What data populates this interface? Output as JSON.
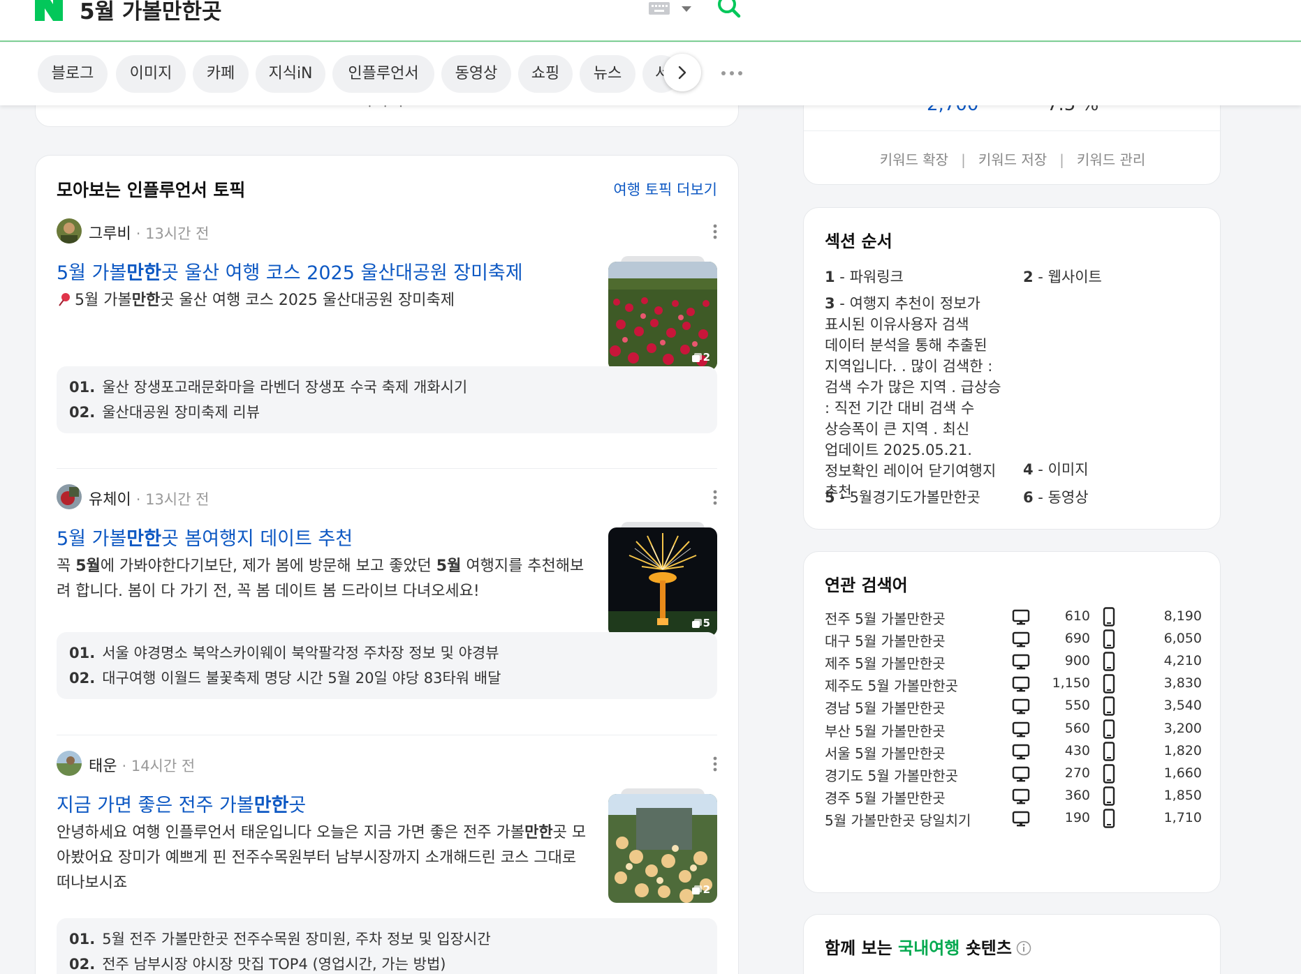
{
  "header": {
    "query": "5월 가볼만한곳",
    "brand_color": "#03c75a",
    "icons": [
      "naver-logo-icon",
      "keyboard-icon",
      "chevron-down-icon",
      "search-icon"
    ]
  },
  "tabs": [
    {
      "label": "블로그"
    },
    {
      "label": "이미지"
    },
    {
      "label": "카페"
    },
    {
      "label": "지식iN"
    },
    {
      "label": "인플루언서"
    },
    {
      "label": "동영상"
    },
    {
      "label": "쇼핑"
    },
    {
      "label": "뉴스"
    },
    {
      "label": "서"
    }
  ],
  "influencer": {
    "title": "모아보는 인플루언서 토픽",
    "more_link": "여행 토픽 더보기",
    "link_color": "#0d58c3",
    "posts": [
      {
        "author": "그루비",
        "time": "· 13시간 전",
        "title_pre": "5월 가볼",
        "title_bold": "만한",
        "title_post": "곳 울산 여행 코스 2025 울산대공원 장미축제",
        "desc_pre": "5월 가볼",
        "desc_bold": "만한",
        "desc_post": "곳 울산 여행 코스 2025 울산대공원 장미축제",
        "image_count": "2",
        "subs": [
          {
            "num": "01.",
            "text": "울산 장생포고래문화마을 라벤더 장생포 수국 축제 개화시기"
          },
          {
            "num": "02.",
            "text": "울산대공원 장미축제 리뷰"
          }
        ]
      },
      {
        "author": "유체이",
        "time": "· 13시간 전",
        "title_pre": "5월 가볼",
        "title_bold": "만한",
        "title_post": "곳 봄여행지 데이트 추천",
        "desc_a": "꼭 ",
        "desc_b": "5월",
        "desc_c": "에 가봐야한다기보단, 제가 봄에 방문해 보고 좋았던 ",
        "desc_d": "5월",
        "desc_e": " 여행지를 추천해보려 합니다. 봄이 다 가기 전, 꼭 봄 데이트 봄 드라이브 다녀오세요!",
        "image_count": "5",
        "subs": [
          {
            "num": "01.",
            "text": "서울 야경명소 북악스카이웨이 북악팔각정 주차장 정보 및 야경뷰"
          },
          {
            "num": "02.",
            "text": "대구여행 이월드 불꽃축제 명당 시간 5월 20일 야당 83타워 배달"
          }
        ]
      },
      {
        "author": "태운",
        "time": "· 14시간 전",
        "title_pre": "지금 가면 좋은 전주 가볼",
        "title_bold": "만한",
        "title_post": "곳",
        "desc_a": "안녕하세요 여행 인플루언서 태운입니다 오늘은 지금 가면 좋은 전주 가볼",
        "desc_b": "만한",
        "desc_c": "곳 모아봤어요 장미가 예쁘게 핀 전주수목원부터 남부시장까지 소개해드린 코스 그대로 떠나보시죠",
        "image_count": "2",
        "subs": [
          {
            "num": "01.",
            "text": "5월 전주 가볼만한곳 전주수목원 장미원, 주차 정보 및 입장시간"
          },
          {
            "num": "02.",
            "text": "전주 남부시장 야시장 맛집 TOP4 (영업시간, 가는 방법)"
          }
        ]
      }
    ]
  },
  "keyword": {
    "value_left": "2,700",
    "value_right": "7.5 %",
    "actions": [
      "키워드 확장",
      "키워드 저장",
      "키워드 관리"
    ],
    "separator": "|"
  },
  "section_order": {
    "title": "섹션 순서",
    "items": [
      {
        "num": "1",
        "label": "파워링크"
      },
      {
        "num": "2",
        "label": "웹사이트"
      },
      {
        "num": "3",
        "label": "여행지 추천이 정보가 표시된 이유사용자 검색 데이터 분석을 통해 추출된 지역입니다. . 많이 검색한 : 검색 수가 많은 지역 . 급상승 : 직전 기간 대비 검색 수 상승폭이 큰 지역 . 최신 업데이트 2025.05.21.정보확인 레이어 닫기여행지 추천"
      },
      {
        "num": "4",
        "label": "이미지"
      },
      {
        "num": "5",
        "label": "5월경기도가볼만한곳"
      },
      {
        "num": "6",
        "label": "동영상"
      }
    ],
    "dash": " - "
  },
  "related": {
    "title": "연관 검색어",
    "rows": [
      {
        "keyword": "전주 5월 가볼만한곳",
        "pc": "610",
        "mobile": "8,190"
      },
      {
        "keyword": "대구 5월 가볼만한곳",
        "pc": "690",
        "mobile": "6,050"
      },
      {
        "keyword": "제주 5월 가볼만한곳",
        "pc": "900",
        "mobile": "4,210"
      },
      {
        "keyword": "제주도 5월 가볼만한곳",
        "pc": "1,150",
        "mobile": "3,830"
      },
      {
        "keyword": "경남 5월 가볼만한곳",
        "pc": "550",
        "mobile": "3,540"
      },
      {
        "keyword": "부산 5월 가볼만한곳",
        "pc": "560",
        "mobile": "3,200"
      },
      {
        "keyword": "서울 5월 가볼만한곳",
        "pc": "430",
        "mobile": "1,820"
      },
      {
        "keyword": "경기도 5월 가볼만한곳",
        "pc": "270",
        "mobile": "1,660"
      },
      {
        "keyword": "경주 5월 가볼만한곳",
        "pc": "360",
        "mobile": "1,850"
      },
      {
        "keyword": "5월 가볼만한곳 당일치기",
        "pc": "190",
        "mobile": "1,710"
      }
    ]
  },
  "shorts": {
    "title_pre": "함께 보는 ",
    "title_highlight": "국내여행",
    "title_post": " 숏텐츠",
    "highlight_color": "#03a94f"
  }
}
